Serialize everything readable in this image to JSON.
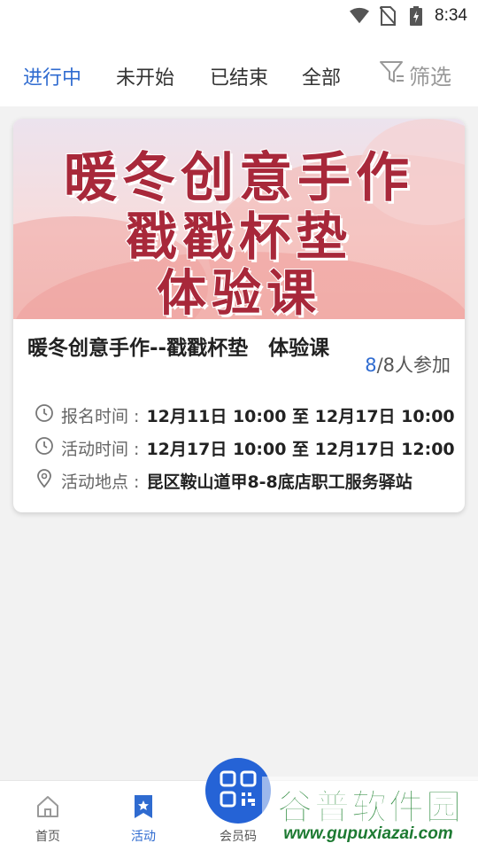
{
  "status_bar": {
    "time": "8:34",
    "icons": [
      "wifi-icon",
      "no-sim-icon",
      "battery-charging-icon"
    ]
  },
  "tabs": [
    {
      "label": "进行中",
      "active": true
    },
    {
      "label": "未开始",
      "active": false
    },
    {
      "label": "已结束",
      "active": false
    },
    {
      "label": "全部",
      "active": false
    }
  ],
  "filter": {
    "label": "筛选",
    "icon": "filter-icon"
  },
  "activity_card": {
    "banner": {
      "line1": "暖冬创意手作",
      "line2": "戳戳杯垫",
      "line3": "体验课"
    },
    "title": "暖冬创意手作--戳戳杯垫　体验课",
    "participants": {
      "joined": "8",
      "rest": "/8人参加"
    },
    "signup_label": "报名时间 :",
    "signup_value": "12月11日 10:00 至 12月17日 10:00",
    "activity_label": "活动时间 :",
    "activity_value": "12月17日 10:00 至 12月17日 12:00",
    "location_label": "活动地点 :",
    "location_value": "昆区鞍山道甲8-8底店职工服务驿站"
  },
  "bottom_nav": [
    {
      "label": "首页",
      "icon": "home-icon",
      "active": false
    },
    {
      "label": "活动",
      "icon": "bookmark-star-icon",
      "active": true
    },
    {
      "label": "会员码",
      "icon": "qr-code-icon",
      "active": false
    }
  ],
  "watermark": {
    "title": "谷普软件园",
    "url": "www.gupuxiazai.com"
  },
  "colors": {
    "accent": "#2f6bd0",
    "fab": "#2563d6",
    "banner_text": "#a8283a"
  }
}
